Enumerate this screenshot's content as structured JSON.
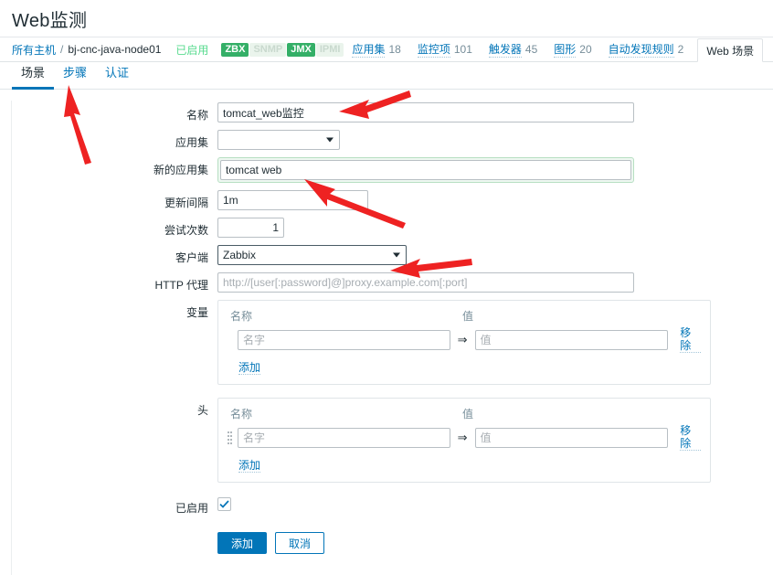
{
  "page": {
    "title": "Web监测"
  },
  "hostbar": {
    "all_hosts": "所有主机",
    "separator": "/",
    "host_name": "bj-cnc-java-node01",
    "status": "已启用",
    "protocols": [
      {
        "label": "ZBX",
        "active": true
      },
      {
        "label": "SNMP",
        "active": false
      },
      {
        "label": "JMX",
        "active": true
      },
      {
        "label": "IPMI",
        "active": false
      }
    ],
    "tabs": [
      {
        "label": "应用集",
        "count": "18",
        "active": false
      },
      {
        "label": "监控项",
        "count": "101",
        "active": false
      },
      {
        "label": "触发器",
        "count": "45",
        "active": false
      },
      {
        "label": "图形",
        "count": "20",
        "active": false
      },
      {
        "label": "自动发现规则",
        "count": "2",
        "active": false
      },
      {
        "label": "Web 场景",
        "count": "",
        "active": true
      }
    ]
  },
  "form_tabs": [
    {
      "label": "场景",
      "active": true
    },
    {
      "label": "步骤",
      "active": false
    },
    {
      "label": "认证",
      "active": false
    }
  ],
  "form": {
    "name": {
      "label": "名称",
      "value": "tomcat_web监控"
    },
    "application": {
      "label": "应用集",
      "value": "",
      "options": [
        ""
      ]
    },
    "new_application": {
      "label": "新的应用集",
      "value": "tomcat web",
      "highlight_color": "#b7dfc2"
    },
    "update_interval": {
      "label": "更新间隔",
      "value": "1m"
    },
    "retries": {
      "label": "尝试次数",
      "value": "1"
    },
    "agent": {
      "label": "客户端",
      "value": "Zabbix",
      "options": [
        "Zabbix"
      ]
    },
    "http_proxy": {
      "label": "HTTP 代理",
      "value": "",
      "placeholder": "http://[user[:password]@]proxy.example.com[:port]"
    },
    "variables": {
      "label": "变量",
      "col_name": "名称",
      "col_value": "值",
      "rows": [
        {
          "name": "",
          "name_placeholder": "名字",
          "value": "",
          "value_placeholder": "值",
          "remove_label": "移除"
        }
      ],
      "add_label": "添加"
    },
    "headers": {
      "label": "头",
      "col_name": "名称",
      "col_value": "值",
      "rows": [
        {
          "name": "",
          "name_placeholder": "名字",
          "value": "",
          "value_placeholder": "值",
          "remove_label": "移除"
        }
      ],
      "add_label": "添加"
    },
    "enabled": {
      "label": "已启用",
      "checked": true
    },
    "arrow_symbol": "⇒"
  },
  "buttons": {
    "submit": "添加",
    "cancel": "取消"
  },
  "annotations": {
    "color": "#ee2222",
    "items": [
      {
        "name": "arrow-to-steps-tab"
      },
      {
        "name": "arrow-to-name-field"
      },
      {
        "name": "arrow-to-new-application-field"
      },
      {
        "name": "arrow-to-agent-field"
      }
    ]
  }
}
